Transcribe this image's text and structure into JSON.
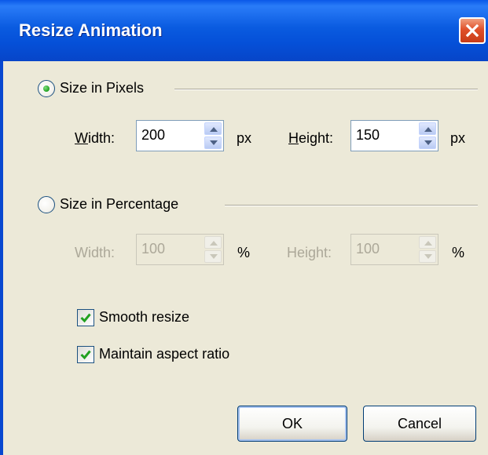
{
  "window": {
    "title": "Resize Animation",
    "colors": {
      "titlebar": "#0a5be0",
      "face": "#ece9d8",
      "close": "#e0502a"
    },
    "close_icon": "close-icon"
  },
  "pixels": {
    "option_label": "Size in Pixels",
    "selected": true,
    "width_label": "Width:",
    "width_value": "200",
    "width_unit": "px",
    "height_label": "Height:",
    "height_value": "150",
    "height_unit": "px",
    "enabled": true
  },
  "percentage": {
    "option_label": "Size in Percentage",
    "selected": false,
    "width_label": "Width:",
    "width_value": "100",
    "width_unit": "%",
    "height_label": "Height:",
    "height_value": "100",
    "height_unit": "%",
    "enabled": false
  },
  "options": {
    "smooth_resize_label": "Smooth resize",
    "smooth_resize_checked": true,
    "maintain_aspect_label": "Maintain aspect ratio",
    "maintain_aspect_checked": true
  },
  "buttons": {
    "ok_label": "OK",
    "cancel_label": "Cancel"
  }
}
